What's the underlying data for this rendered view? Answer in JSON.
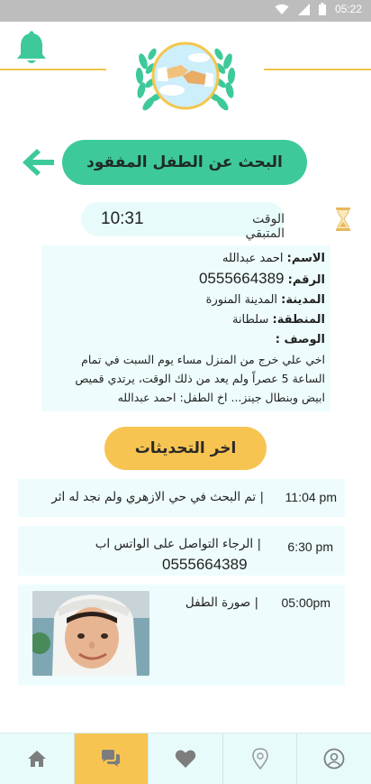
{
  "status_bar": {
    "time": "05:22"
  },
  "header": {
    "logo": "hands-logo-with-laurel"
  },
  "title": {
    "text": "البحث عن الطفل المفقود"
  },
  "timer": {
    "label": "الوقت المتبقي",
    "value": "10:31"
  },
  "child_info": {
    "name_label": "الاسم:",
    "name_value": "احمد عبدالله",
    "number_label": "الرقم:",
    "number_value": "0555664389",
    "city_label": "المدينة:",
    "city_value": "المدينة المنورة",
    "area_label": "المنطقة:",
    "area_value": "سلطانة",
    "desc_label": "الوصف :",
    "desc_line1": "اخي علي خرج من المنزل مساء يوم السبت  في تمام",
    "desc_line2": "الساعة 5 عصراً ولم يعد من ذلك الوقت، يرتدي قميص",
    "desc_line3": "ابيض وبنطال جينز... اخ الطفل: احمد عبدالله"
  },
  "updates_title": "اخر التحديثات",
  "updates": [
    {
      "time": "11:04 pm",
      "text": "تم البحث في حي الازهري ولم نجد له اثر"
    },
    {
      "time": "6:30 pm",
      "text": "الرجاء التواصل على الواتس اب",
      "phone": "0555664389"
    },
    {
      "time": "05:00pm",
      "text": "صورة الطفل"
    }
  ],
  "colors": {
    "primary_green": "#3ec99a",
    "accent_yellow": "#f7c452",
    "card_bg": "#eefcfd"
  },
  "nav": {
    "items": [
      {
        "icon": "home-icon"
      },
      {
        "icon": "chat-icon",
        "active": true
      },
      {
        "icon": "heart-icon"
      },
      {
        "icon": "location-pin-icon"
      },
      {
        "icon": "user-icon"
      }
    ]
  }
}
